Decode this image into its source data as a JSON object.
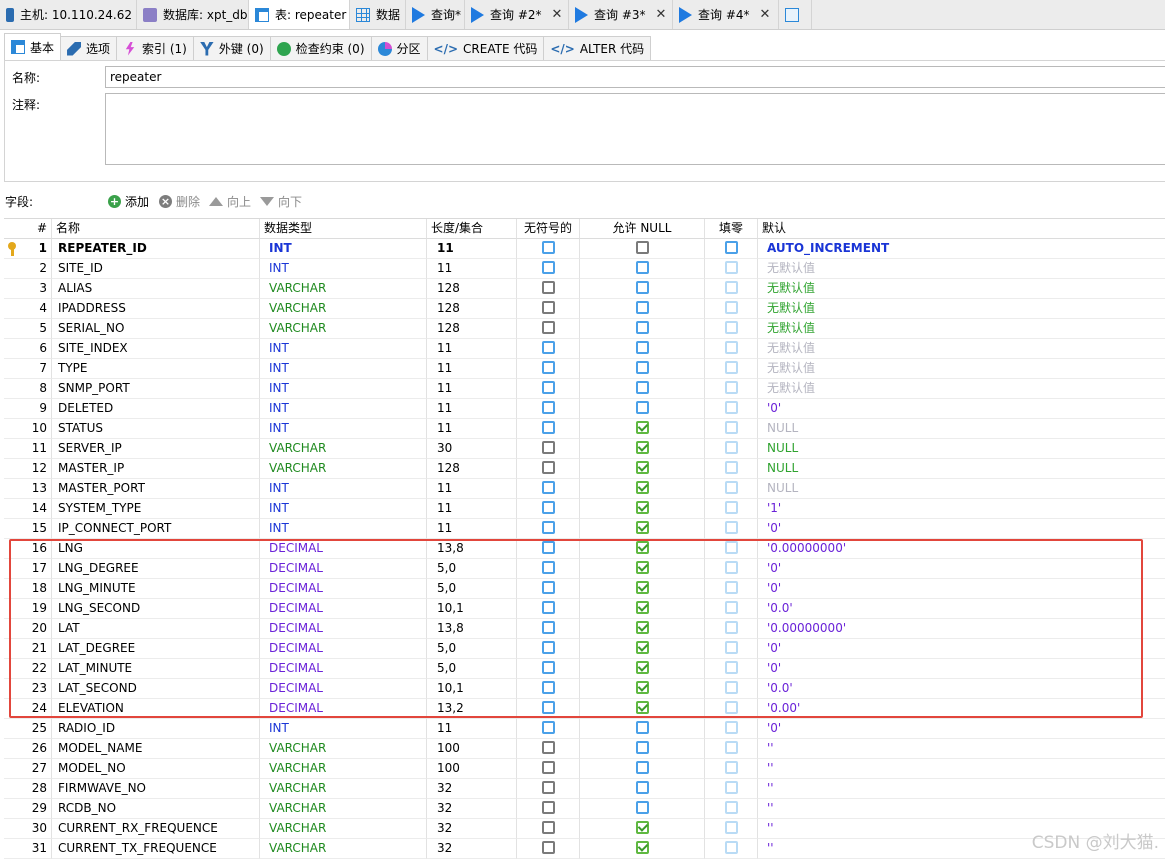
{
  "window_tabs": [
    {
      "label": "主机: 10.110.24.62",
      "icon": "host-icon",
      "closable": false
    },
    {
      "label": "数据库: xpt_db",
      "icon": "database-icon",
      "closable": false
    },
    {
      "label": "表: repeater",
      "icon": "table-icon",
      "closable": false,
      "active": true
    },
    {
      "label": "数据",
      "icon": "data-grid-icon",
      "closable": false
    },
    {
      "label": "查询*",
      "icon": "query-play-icon",
      "closable": false
    },
    {
      "label": "查询 #2*",
      "icon": "query-play-icon",
      "closable": true
    },
    {
      "label": "查询 #3*",
      "icon": "query-play-icon",
      "closable": true
    },
    {
      "label": "查询 #4*",
      "icon": "query-play-icon",
      "closable": true
    }
  ],
  "close_glyph": "✕",
  "sub_tabs": [
    {
      "label": "基本",
      "icon": "basic-icon",
      "active": true
    },
    {
      "label": "选项",
      "icon": "wrench-icon"
    },
    {
      "label": "索引 (1)",
      "icon": "bolt-icon"
    },
    {
      "label": "外键 (0)",
      "icon": "foreign-key-icon"
    },
    {
      "label": "检查约束 (0)",
      "icon": "check-icon"
    },
    {
      "label": "分区",
      "icon": "partition-icon"
    },
    {
      "label": "CREATE 代码",
      "icon": "code-icon"
    },
    {
      "label": "ALTER 代码",
      "icon": "code-icon"
    }
  ],
  "code_glyph": "</>",
  "properties": {
    "name_label": "名称:",
    "name_value": "repeater",
    "comment_label": "注释:",
    "comment_value": ""
  },
  "fields_toolbar": {
    "label": "字段:",
    "add": "添加",
    "delete": "删除",
    "up": "向上",
    "down": "向下"
  },
  "columns": {
    "num": "#",
    "name": "名称",
    "type": "数据类型",
    "length": "长度/集合",
    "unsigned": "无符号的",
    "allow_null": "允许 NULL",
    "zerofill": "填零",
    "default": "默认"
  },
  "rows": [
    {
      "n": "1",
      "name": "REPEATER_ID",
      "type": "INT",
      "len": "11",
      "uns": "blue",
      "null": "gray",
      "zero": "blue",
      "def": "AUTO_INCREMENT",
      "dcls": "auto",
      "pk": true
    },
    {
      "n": "2",
      "name": "SITE_ID",
      "type": "INT",
      "len": "11",
      "uns": "blue",
      "null": "blue",
      "zero": "ltblue",
      "def": "无默认值",
      "dcls": "none"
    },
    {
      "n": "3",
      "name": "ALIAS",
      "type": "VARCHAR",
      "len": "128",
      "uns": "gray",
      "null": "blue",
      "zero": "ltblue",
      "def": "无默认值",
      "dcls": "gnone"
    },
    {
      "n": "4",
      "name": "IPADDRESS",
      "type": "VARCHAR",
      "len": "128",
      "uns": "gray",
      "null": "blue",
      "zero": "ltblue",
      "def": "无默认值",
      "dcls": "gnone"
    },
    {
      "n": "5",
      "name": "SERIAL_NO",
      "type": "VARCHAR",
      "len": "128",
      "uns": "gray",
      "null": "blue",
      "zero": "ltblue",
      "def": "无默认值",
      "dcls": "gnone"
    },
    {
      "n": "6",
      "name": "SITE_INDEX",
      "type": "INT",
      "len": "11",
      "uns": "blue",
      "null": "blue",
      "zero": "ltblue",
      "def": "无默认值",
      "dcls": "none"
    },
    {
      "n": "7",
      "name": "TYPE",
      "type": "INT",
      "len": "11",
      "uns": "blue",
      "null": "blue",
      "zero": "ltblue",
      "def": "无默认值",
      "dcls": "none"
    },
    {
      "n": "8",
      "name": "SNMP_PORT",
      "type": "INT",
      "len": "11",
      "uns": "blue",
      "null": "blue",
      "zero": "ltblue",
      "def": "无默认值",
      "dcls": "none"
    },
    {
      "n": "9",
      "name": "DELETED",
      "type": "INT",
      "len": "11",
      "uns": "blue",
      "null": "blue",
      "zero": "ltblue",
      "def": "'0'",
      "dcls": "str"
    },
    {
      "n": "10",
      "name": "STATUS",
      "type": "INT",
      "len": "11",
      "uns": "blue",
      "null": "on",
      "zero": "ltblue",
      "def": "NULL",
      "dcls": "null"
    },
    {
      "n": "11",
      "name": "SERVER_IP",
      "type": "VARCHAR",
      "len": "30",
      "uns": "gray",
      "null": "on",
      "zero": "ltblue",
      "def": "NULL",
      "dcls": "gnull"
    },
    {
      "n": "12",
      "name": "MASTER_IP",
      "type": "VARCHAR",
      "len": "128",
      "uns": "gray",
      "null": "on",
      "zero": "ltblue",
      "def": "NULL",
      "dcls": "gnull"
    },
    {
      "n": "13",
      "name": "MASTER_PORT",
      "type": "INT",
      "len": "11",
      "uns": "blue",
      "null": "on",
      "zero": "ltblue",
      "def": "NULL",
      "dcls": "null"
    },
    {
      "n": "14",
      "name": "SYSTEM_TYPE",
      "type": "INT",
      "len": "11",
      "uns": "blue",
      "null": "on",
      "zero": "ltblue",
      "def": "'1'",
      "dcls": "str"
    },
    {
      "n": "15",
      "name": "IP_CONNECT_PORT",
      "type": "INT",
      "len": "11",
      "uns": "blue",
      "null": "on",
      "zero": "ltblue",
      "def": "'0'",
      "dcls": "str"
    },
    {
      "n": "16",
      "name": "LNG",
      "type": "DECIMAL",
      "len": "13,8",
      "uns": "blue",
      "null": "on",
      "zero": "ltblue",
      "def": "'0.00000000'",
      "dcls": "str"
    },
    {
      "n": "17",
      "name": "LNG_DEGREE",
      "type": "DECIMAL",
      "len": "5,0",
      "uns": "blue",
      "null": "on",
      "zero": "ltblue",
      "def": "'0'",
      "dcls": "str"
    },
    {
      "n": "18",
      "name": "LNG_MINUTE",
      "type": "DECIMAL",
      "len": "5,0",
      "uns": "blue",
      "null": "on",
      "zero": "ltblue",
      "def": "'0'",
      "dcls": "str"
    },
    {
      "n": "19",
      "name": "LNG_SECOND",
      "type": "DECIMAL",
      "len": "10,1",
      "uns": "blue",
      "null": "on",
      "zero": "ltblue",
      "def": "'0.0'",
      "dcls": "str"
    },
    {
      "n": "20",
      "name": "LAT",
      "type": "DECIMAL",
      "len": "13,8",
      "uns": "blue",
      "null": "on",
      "zero": "ltblue",
      "def": "'0.00000000'",
      "dcls": "str"
    },
    {
      "n": "21",
      "name": "LAT_DEGREE",
      "type": "DECIMAL",
      "len": "5,0",
      "uns": "blue",
      "null": "on",
      "zero": "ltblue",
      "def": "'0'",
      "dcls": "str"
    },
    {
      "n": "22",
      "name": "LAT_MINUTE",
      "type": "DECIMAL",
      "len": "5,0",
      "uns": "blue",
      "null": "on",
      "zero": "ltblue",
      "def": "'0'",
      "dcls": "str"
    },
    {
      "n": "23",
      "name": "LAT_SECOND",
      "type": "DECIMAL",
      "len": "10,1",
      "uns": "blue",
      "null": "on",
      "zero": "ltblue",
      "def": "'0.0'",
      "dcls": "str"
    },
    {
      "n": "24",
      "name": "ELEVATION",
      "type": "DECIMAL",
      "len": "13,2",
      "uns": "blue",
      "null": "on",
      "zero": "ltblue",
      "def": "'0.00'",
      "dcls": "str"
    },
    {
      "n": "25",
      "name": "RADIO_ID",
      "type": "INT",
      "len": "11",
      "uns": "blue",
      "null": "blue",
      "zero": "ltblue",
      "def": "'0'",
      "dcls": "str"
    },
    {
      "n": "26",
      "name": "MODEL_NAME",
      "type": "VARCHAR",
      "len": "100",
      "uns": "gray",
      "null": "blue",
      "zero": "ltblue",
      "def": "''",
      "dcls": "str"
    },
    {
      "n": "27",
      "name": "MODEL_NO",
      "type": "VARCHAR",
      "len": "100",
      "uns": "gray",
      "null": "blue",
      "zero": "ltblue",
      "def": "''",
      "dcls": "str"
    },
    {
      "n": "28",
      "name": "FIRMWAVE_NO",
      "type": "VARCHAR",
      "len": "32",
      "uns": "gray",
      "null": "blue",
      "zero": "ltblue",
      "def": "''",
      "dcls": "str"
    },
    {
      "n": "29",
      "name": "RCDB_NO",
      "type": "VARCHAR",
      "len": "32",
      "uns": "gray",
      "null": "blue",
      "zero": "ltblue",
      "def": "''",
      "dcls": "str"
    },
    {
      "n": "30",
      "name": "CURRENT_RX_FREQUENCE",
      "type": "VARCHAR",
      "len": "32",
      "uns": "gray",
      "null": "on",
      "zero": "ltblue",
      "def": "''",
      "dcls": "str"
    },
    {
      "n": "31",
      "name": "CURRENT_TX_FREQUENCE",
      "type": "VARCHAR",
      "len": "32",
      "uns": "gray",
      "null": "on",
      "zero": "ltblue",
      "def": "''",
      "dcls": "str"
    }
  ],
  "watermark": "CSDN @刘大猫.",
  "colors": {
    "int": "#1a35d6",
    "varchar": "#1f8a1f",
    "decimal": "#6a22d8",
    "highlight": "#e2463c"
  }
}
